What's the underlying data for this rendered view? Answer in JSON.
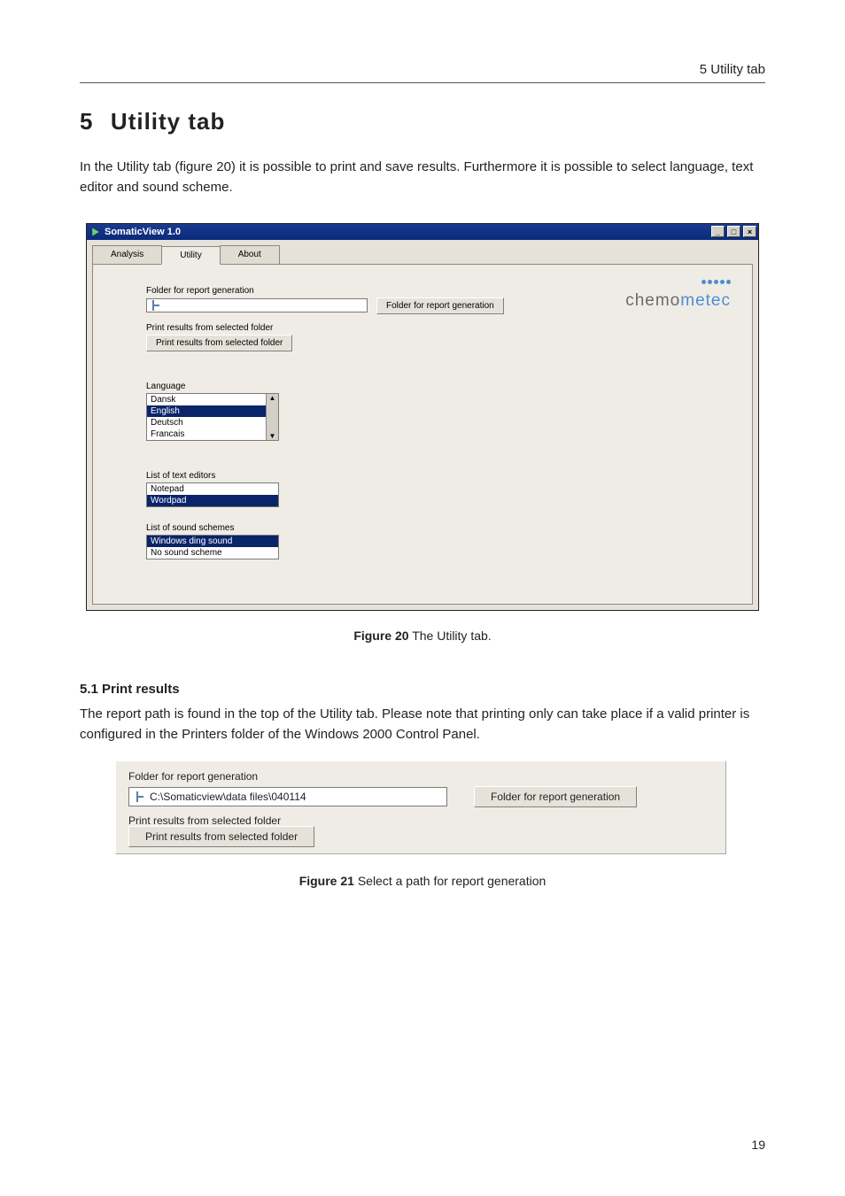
{
  "header": {
    "title": "5 Utility tab"
  },
  "section": {
    "number": "5",
    "title": "Utility tab",
    "intro": "In the Utility tab (figure 20) it is possible to print and save results. Furthermore it is possible to select language, text editor and sound scheme."
  },
  "fig20": {
    "window_title": "SomaticView 1.0",
    "tabs": [
      "Analysis",
      "Utility",
      "About"
    ],
    "active_tab": "Utility",
    "logo_left": "chemo",
    "logo_right": "metec",
    "folder_label": "Folder for report generation",
    "folder_value_icon": "tree-icon",
    "folder_button": "Folder for report generation",
    "print_label": "Print results from selected folder",
    "print_button": "Print results from selected folder",
    "language_label": "Language",
    "language_items": [
      "Dansk",
      "English",
      "Deutsch",
      "Francais"
    ],
    "language_selected": "English",
    "editors_label": "List of text editors",
    "editors_items": [
      "Notepad",
      "Wordpad"
    ],
    "editors_selected": "Wordpad",
    "sound_label": "List of sound schemes",
    "sound_items": [
      "Windows ding sound",
      "No sound scheme"
    ],
    "sound_selected": "Windows ding sound",
    "caption_bold": "Figure 20",
    "caption_rest": " The Utility tab."
  },
  "section51": {
    "heading": "5.1    Print results",
    "body": "The report path is found in the top of the Utility tab. Please note that printing only can take place if a valid printer is configured in the Printers folder of the Windows 2000 Control Panel."
  },
  "fig21": {
    "folder_label": "Folder for report generation",
    "folder_path": "C:\\Somaticview\\data files\\040114",
    "folder_button": "Folder for report generation",
    "print_label": "Print results from selected folder",
    "print_button": "Print results from selected folder",
    "caption_bold": "Figure 21",
    "caption_rest": " Select a path for report generation"
  },
  "page_number": "19"
}
